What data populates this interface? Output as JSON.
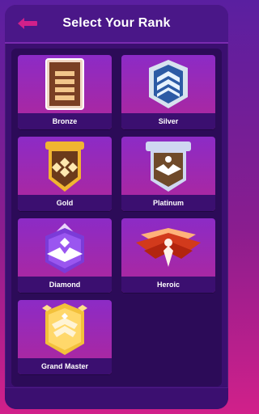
{
  "header": {
    "title": "Select Your Rank",
    "back_icon": "back-arrow-icon"
  },
  "ranks": [
    {
      "label": "Bronze"
    },
    {
      "label": "Silver"
    },
    {
      "label": "Gold"
    },
    {
      "label": "Platinum"
    },
    {
      "label": "Diamond"
    },
    {
      "label": "Heroic"
    },
    {
      "label": "Grand Master"
    }
  ],
  "colors": {
    "accent": "#d1208a",
    "header_bg": "#4a1788",
    "card_top": "#8c2bc6",
    "card_bottom": "#b0279a"
  }
}
